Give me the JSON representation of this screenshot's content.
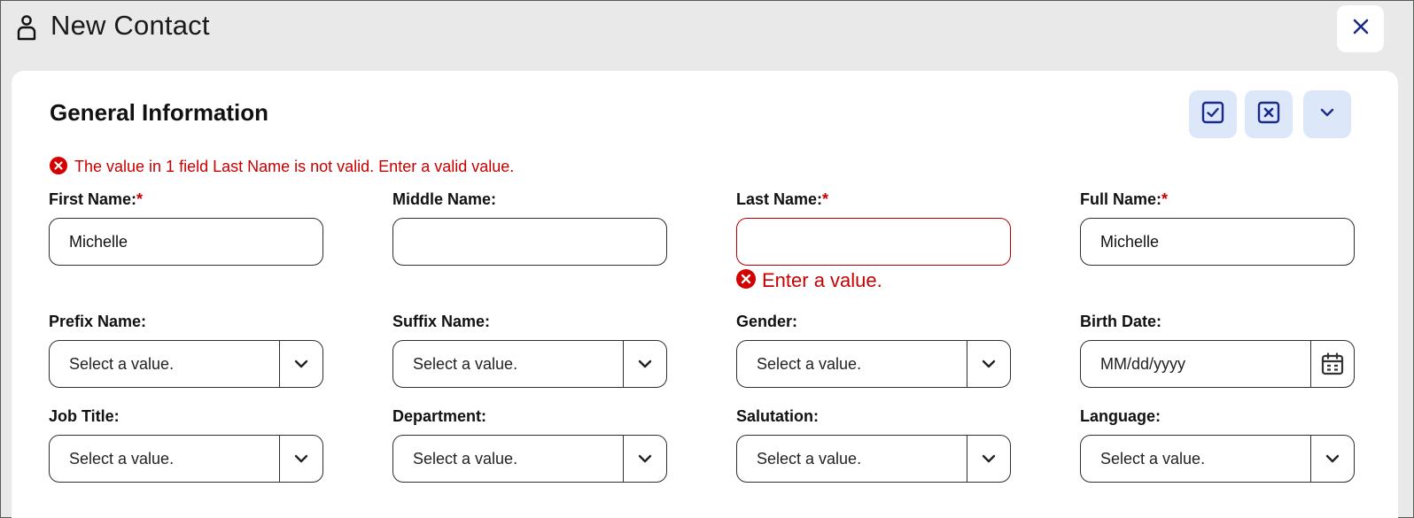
{
  "window": {
    "title": "New Contact",
    "close_label": "close"
  },
  "section": {
    "title": "General Information",
    "actions": [
      {
        "name": "save-check-icon"
      },
      {
        "name": "discard-x-icon"
      },
      {
        "name": "collapse-chevron-icon"
      }
    ],
    "form_error": "The value in 1 field Last Name is not valid. Enter a valid value."
  },
  "fields": {
    "first_name": {
      "label": "First Name:",
      "required": "*",
      "value": "Michelle"
    },
    "middle_name": {
      "label": "Middle Name:",
      "value": ""
    },
    "last_name": {
      "label": "Last Name:",
      "required": "*",
      "value": "",
      "error": "Enter a value."
    },
    "full_name": {
      "label": "Full Name:",
      "required": "*",
      "value": "Michelle"
    },
    "prefix_name": {
      "label": "Prefix Name:",
      "value": "Select a value."
    },
    "suffix_name": {
      "label": "Suffix Name:",
      "value": "Select a value."
    },
    "gender": {
      "label": "Gender:",
      "value": "Select a value."
    },
    "birth_date": {
      "label": "Birth Date:",
      "placeholder": "MM/dd/yyyy"
    },
    "job_title": {
      "label": "Job Title:",
      "value": "Select a value."
    },
    "department": {
      "label": "Department:",
      "value": "Select a value."
    },
    "salutation": {
      "label": "Salutation:",
      "value": "Select a value."
    },
    "language": {
      "label": "Language:",
      "value": "Select a value."
    }
  },
  "colors": {
    "error": "#c80000",
    "accent": "#1a2a8a",
    "action_bg": "#dce8f9"
  }
}
